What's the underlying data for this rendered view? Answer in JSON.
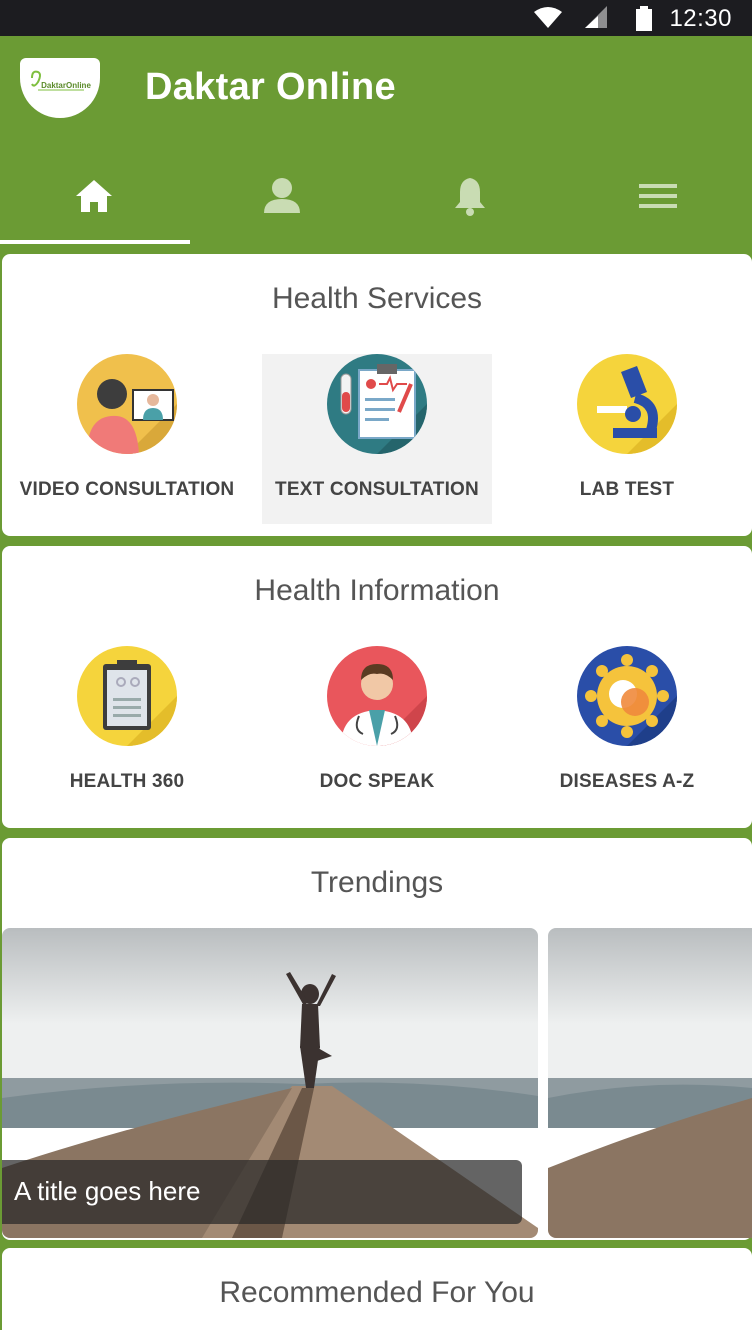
{
  "status_bar": {
    "time": "12:30",
    "icons": [
      "wifi-icon",
      "signal-icon",
      "battery-icon"
    ]
  },
  "app": {
    "title": "Daktar Online",
    "logo_text": "DaktarOnline"
  },
  "tabs": [
    {
      "icon": "home-icon",
      "active": true
    },
    {
      "icon": "profile-icon",
      "active": false
    },
    {
      "icon": "bell-icon",
      "active": false
    },
    {
      "icon": "menu-icon",
      "active": false
    }
  ],
  "health_services": {
    "title": "Health Services",
    "items": [
      {
        "label": "VIDEO CONSULTATION",
        "icon": "video-consultation-icon"
      },
      {
        "label": "TEXT CONSULTATION",
        "icon": "text-consultation-icon",
        "selected": true
      },
      {
        "label": "LAB TEST",
        "icon": "microscope-icon"
      }
    ]
  },
  "health_information": {
    "title": "Health Information",
    "items": [
      {
        "label": "HEALTH 360",
        "icon": "clipboard-icon"
      },
      {
        "label": "DOC SPEAK",
        "icon": "doctor-icon"
      },
      {
        "label": "DISEASES A-Z",
        "icon": "virus-icon"
      }
    ]
  },
  "trendings": {
    "title": "Trendings",
    "cards": [
      {
        "caption": "A title goes here",
        "image": "yoga-beach-image"
      },
      {
        "caption": "",
        "image": "yoga-beach-image"
      }
    ]
  },
  "recommended": {
    "title": "Recommended For You"
  },
  "colors": {
    "primary": "#6b9b34",
    "status_bar": "#1c1c20",
    "card": "#ffffff",
    "text": "#555555"
  }
}
